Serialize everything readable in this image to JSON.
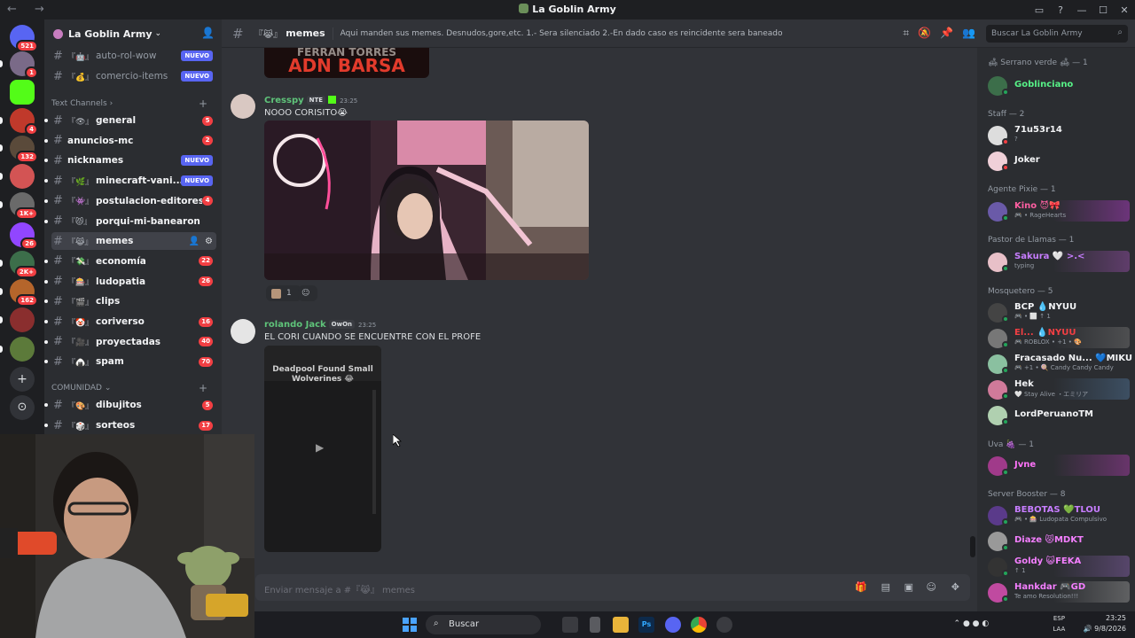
{
  "window": {
    "title": "La Goblin Army",
    "nav": "← →",
    "controls": [
      "inbox",
      "help",
      "min",
      "max",
      "close"
    ]
  },
  "rail": {
    "items": [
      {
        "name": "home",
        "badge": "521",
        "color": "#5865f2"
      },
      {
        "name": "server-1",
        "badge": "1",
        "color": "#7a6a88"
      },
      {
        "name": "kick",
        "badge": "",
        "color": "#53fc18"
      },
      {
        "name": "server-3",
        "badge": "4",
        "color": "#c0392b"
      },
      {
        "name": "server-4",
        "badge": "132",
        "color": "#5a4a3a"
      },
      {
        "name": "server-5",
        "badge": "",
        "color": "#d35454"
      },
      {
        "name": "server-6",
        "badge": "1K+",
        "color": "#6a6a6a"
      },
      {
        "name": "twitch",
        "badge": "26",
        "color": "#9146ff"
      },
      {
        "name": "server-8",
        "badge": "2K+",
        "color": "#3c6e4a"
      },
      {
        "name": "server-9",
        "badge": "162",
        "color": "#b5652b"
      },
      {
        "name": "server-10",
        "badge": "",
        "color": "#8a2e2e"
      },
      {
        "name": "server-11",
        "badge": "",
        "color": "#5c7a3a"
      }
    ],
    "add_icon": "+",
    "discover_icon": "⊙"
  },
  "server": {
    "name": "La Goblin Army"
  },
  "channels_top": [
    {
      "emoji": "『🤖』",
      "name": "auto-rol-wow",
      "nuevo": "NUEVO"
    },
    {
      "emoji": "『💰』",
      "name": "comercio-items",
      "nuevo": "NUEVO"
    }
  ],
  "text_category": "Text Channels",
  "channels": [
    {
      "emoji": "『👁』",
      "name": "general",
      "badge": "5",
      "nuevo": ""
    },
    {
      "emoji": "",
      "name": "anuncios-mc",
      "badge": "2",
      "nuevo": ""
    },
    {
      "emoji": "",
      "name": "nicknames",
      "badge": "",
      "nuevo": "NUEVO"
    },
    {
      "emoji": "『🌿』",
      "name": "minecraft-vani...",
      "badge": "",
      "nuevo": "NUEVO"
    },
    {
      "emoji": "『👾』",
      "name": "postulacion-editores",
      "badge": "4",
      "nuevo": ""
    },
    {
      "emoji": "『😾』",
      "name": "porqui-mi-banearon",
      "badge": "",
      "nuevo": ""
    },
    {
      "emoji": "『😹』",
      "name": "memes",
      "badge": "",
      "nuevo": ""
    },
    {
      "emoji": "『💸』",
      "name": "economía",
      "badge": "22",
      "nuevo": ""
    },
    {
      "emoji": "『🎰』",
      "name": "ludopatia",
      "badge": "26",
      "nuevo": ""
    },
    {
      "emoji": "『🎬』",
      "name": "clips",
      "badge": "",
      "nuevo": ""
    },
    {
      "emoji": "『🤡』",
      "name": "coriverso",
      "badge": "16",
      "nuevo": ""
    },
    {
      "emoji": "『🎥』",
      "name": "proyectadas",
      "badge": "40",
      "nuevo": ""
    },
    {
      "emoji": "『🍙』",
      "name": "spam",
      "badge": "70",
      "nuevo": ""
    }
  ],
  "community_category": "COMUNIDAD",
  "community_channels": [
    {
      "emoji": "『🎨』",
      "name": "dibujitos",
      "badge": "5"
    },
    {
      "emoji": "『🎲』",
      "name": "sorteos",
      "badge": "17"
    }
  ],
  "header": {
    "emoji": "『😹』",
    "channel": "memes",
    "topic": "Aqui manden sus memes. Desnudos,gore,etc. 1.- Sera silenciado 2.-En dado caso es reincidente sera baneado",
    "search_placeholder": "Buscar La Goblin Army"
  },
  "top_image_text": "ADN BARSA",
  "messages": [
    {
      "author": "Cresspy",
      "tag": "NTE",
      "time": "23:25",
      "text": "NOOO CORISITO😭",
      "reaction_count": "1",
      "author_color": "#5fc47a"
    },
    {
      "author": "rolando Jack",
      "tag": "OwOn",
      "time": "23:25",
      "text": "EL CORI CUANDO SE ENCUENTRE CON EL PROFE",
      "video_caption": "Deadpool Found Small Wolverines 😂",
      "author_color": "#5fc47a"
    }
  ],
  "composer": {
    "placeholder": "Enviar mensaje a #『😹』 memes"
  },
  "members": {
    "groups": [
      {
        "label": "🛋 Serrano verde 🛋 — 1"
      },
      {
        "label": "Staff — 2"
      },
      {
        "label": "Agente Pixie — 1"
      },
      {
        "label": "Pastor de Llamas — 1"
      },
      {
        "label": "Mosquetero — 5"
      },
      {
        "label": "Uva 🍇 — 1"
      },
      {
        "label": "Server Booster — 8"
      }
    ],
    "list": [
      {
        "name": "Goblinciano",
        "sub": "",
        "color": "#57f287",
        "status": "#23a55a"
      },
      {
        "name": "71u53r14",
        "sub": "?",
        "color": "#f2f3f5",
        "status": "#f23f43"
      },
      {
        "name": "Joker",
        "sub": "",
        "color": "#f2f3f5",
        "status": "#f23f43"
      },
      {
        "name": "Kino 😈🎀",
        "sub": "🎮 • RageHearts",
        "color": "#ff5fa2",
        "status": "#23a55a"
      },
      {
        "name": "Sakura 🤍 >.<",
        "sub": "typing",
        "color": "#c77dff",
        "status": "#23a55a"
      },
      {
        "name": "BCP 💧NYUU",
        "sub": "🎮 • ⬜ ↑ 1",
        "color": "#f2f3f5",
        "status": "#23a55a"
      },
      {
        "name": "El... 💧NYUU",
        "sub": "🎮 ROBLOX • +1 • 🎨",
        "color": "#f23f43",
        "status": "#23a55a"
      },
      {
        "name": "Fracasado Nu... 💙MIKU",
        "sub": "🎮 +1 • 🍭 Candy Candy Candy",
        "color": "#f2f3f5",
        "status": "#23a55a"
      },
      {
        "name": "Hek",
        "sub": "🤍 Stay Alive ・エミリア",
        "color": "#f2f3f5",
        "status": "#23a55a"
      },
      {
        "name": "LordPeruanoTM",
        "sub": "",
        "color": "#f2f3f5",
        "status": "#23a55a"
      },
      {
        "name": "Jvne",
        "sub": "",
        "color": "#ff73fa",
        "status": "#23a55a"
      },
      {
        "name": "BEBOTAS 💚TLOU",
        "sub": "🎮 • 🎰 Ludopata Compulsivo",
        "color": "#c77dff",
        "status": "#23a55a"
      },
      {
        "name": "Diaze 😾MDKT",
        "sub": "",
        "color": "#f47fff",
        "status": "#23a55a"
      },
      {
        "name": "Goldy 😺FEKA",
        "sub": "↑ 1",
        "color": "#f47fff",
        "status": "#23a55a"
      },
      {
        "name": "Hankdar 🎮GD",
        "sub": "Te amo Resolution!!!",
        "color": "#f47fff",
        "status": "#23a55a"
      }
    ]
  },
  "taskbar": {
    "search": "Buscar",
    "lang": "ESP",
    "lang2": "LAA",
    "time": "23:25",
    "date": "9/8/2026"
  }
}
